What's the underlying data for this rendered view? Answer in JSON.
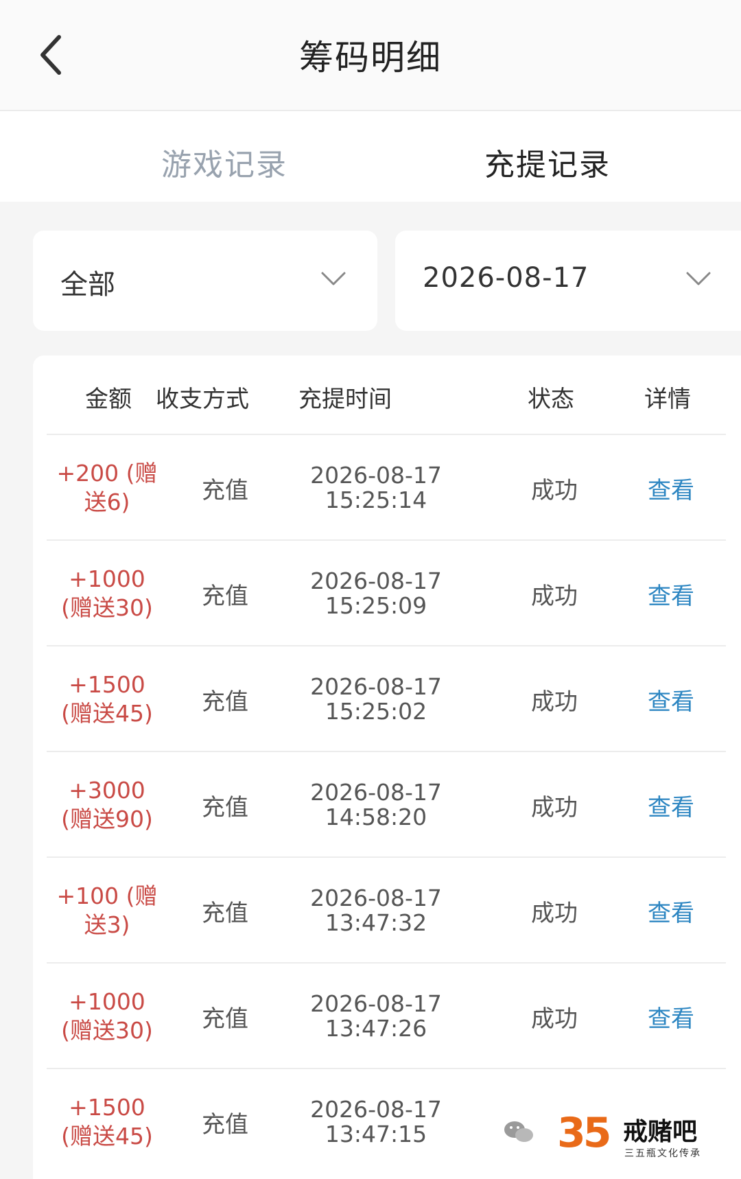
{
  "header": {
    "title": "筹码明细",
    "back_icon": "chevron-left-icon"
  },
  "tabs": [
    {
      "label": "游戏记录",
      "active": false
    },
    {
      "label": "充提记录",
      "active": true
    }
  ],
  "filters": {
    "type": {
      "value": "全部"
    },
    "date": {
      "value": "2026-08-17"
    }
  },
  "table": {
    "columns": [
      "金额",
      "收支方式",
      "充提时间",
      "状态",
      "详情"
    ],
    "rows": [
      {
        "amount": "+200 (赠送6)",
        "method": "充值",
        "date": "2026-08-17",
        "time": "15:25:14",
        "status": "成功",
        "detail": "查看"
      },
      {
        "amount": "+1000 (赠送30)",
        "method": "充值",
        "date": "2026-08-17",
        "time": "15:25:09",
        "status": "成功",
        "detail": "查看"
      },
      {
        "amount": "+1500 (赠送45)",
        "method": "充值",
        "date": "2026-08-17",
        "time": "15:25:02",
        "status": "成功",
        "detail": "查看"
      },
      {
        "amount": "+3000 (赠送90)",
        "method": "充值",
        "date": "2026-08-17",
        "time": "14:58:20",
        "status": "成功",
        "detail": "查看"
      },
      {
        "amount": "+100 (赠送3)",
        "method": "充值",
        "date": "2026-08-17",
        "time": "13:47:32",
        "status": "成功",
        "detail": "查看"
      },
      {
        "amount": "+1000 (赠送30)",
        "method": "充值",
        "date": "2026-08-17",
        "time": "13:47:26",
        "status": "成功",
        "detail": "查看"
      },
      {
        "amount": "+1500 (赠送45)",
        "method": "充值",
        "date": "2026-08-17",
        "time": "13:47:15",
        "status": "",
        "detail": ""
      }
    ]
  },
  "watermark": {
    "number": "35",
    "brand": "戒赌吧",
    "tagline": "三五瓶文化传承"
  },
  "colors": {
    "amount": "#c94a45",
    "link": "#2d86c2",
    "inactive_tab": "#98a2ae",
    "background": "#f5f5f5"
  }
}
